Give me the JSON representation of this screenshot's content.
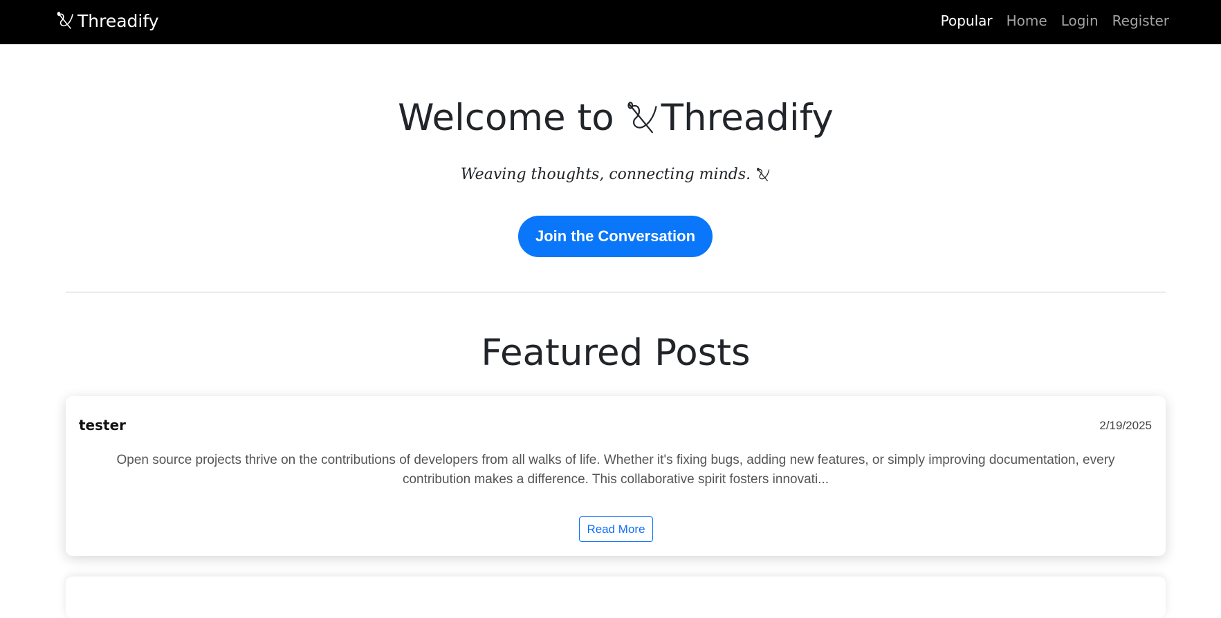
{
  "navbar": {
    "brand": "Threadify",
    "links": [
      {
        "label": "Popular",
        "active": true
      },
      {
        "label": "Home",
        "active": false
      },
      {
        "label": "Login",
        "active": false
      },
      {
        "label": "Register",
        "active": false
      }
    ]
  },
  "hero": {
    "title_prefix": "Welcome to",
    "title_brand": "Threadify",
    "tagline": "Weaving thoughts, connecting minds.",
    "cta_label": "Join the Conversation",
    "icon": "needle-thread-icon"
  },
  "featured": {
    "title": "Featured Posts",
    "posts": [
      {
        "author": "tester",
        "date": "2/19/2025",
        "excerpt": "Open source projects thrive on the contributions of developers from all walks of life. Whether it's fixing bugs, adding new features, or simply improving documentation, every contribution makes a difference. This collaborative spirit fosters innovati...",
        "button_label": "Read More"
      }
    ]
  },
  "colors": {
    "navbar_bg": "#000000",
    "nav_active": "#ffffff",
    "nav_inactive": "#a3a3a3",
    "primary": "#0a77fa"
  }
}
